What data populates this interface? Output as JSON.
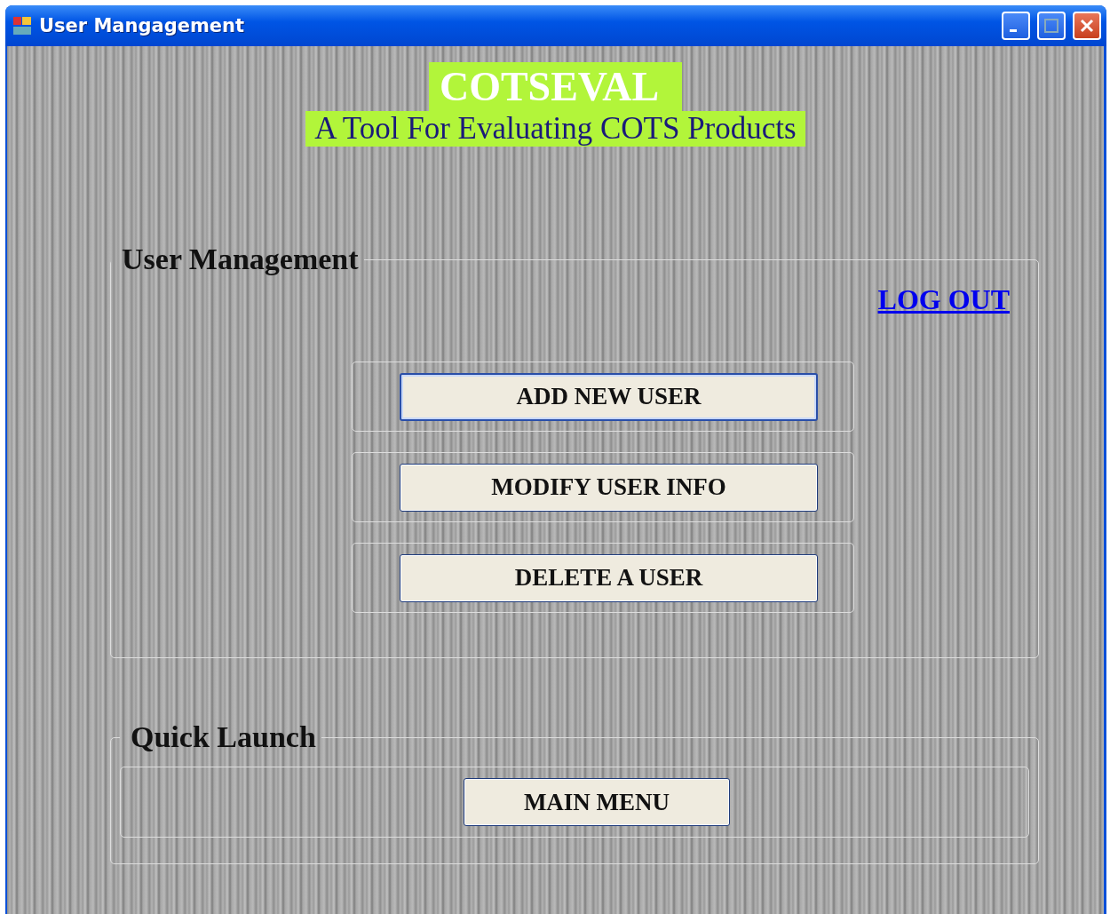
{
  "window": {
    "title": "User Mangagement"
  },
  "header": {
    "title": "COTSEVAL",
    "subtitle": "A Tool For Evaluating COTS Products"
  },
  "user_management": {
    "legend": "User Management",
    "logout_link": "LOG OUT",
    "buttons": [
      {
        "label": "ADD NEW USER",
        "focused": true
      },
      {
        "label": "MODIFY USER INFO",
        "focused": false
      },
      {
        "label": "DELETE A USER",
        "focused": false
      }
    ]
  },
  "quick_launch": {
    "legend": "Quick Launch",
    "buttons": [
      {
        "label": "MAIN MENU",
        "focused": false
      }
    ]
  }
}
